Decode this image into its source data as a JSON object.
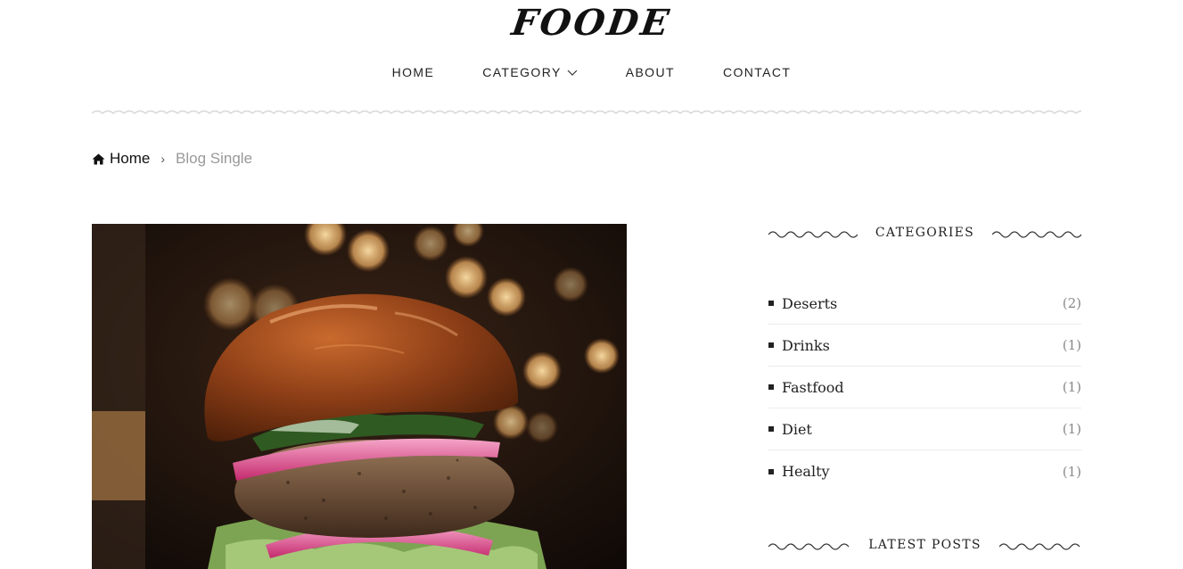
{
  "site": {
    "logo_text": "FOODE"
  },
  "nav": {
    "items": [
      {
        "label": "HOME"
      },
      {
        "label": "CATEGORY"
      },
      {
        "label": "ABOUT"
      },
      {
        "label": "CONTACT"
      }
    ]
  },
  "breadcrumb": {
    "home": "Home",
    "current": "Blog Single"
  },
  "sidebar": {
    "categories_title": "CATEGORIES",
    "categories": [
      {
        "name": "Deserts",
        "count": "(2)"
      },
      {
        "name": "Drinks",
        "count": "(1)"
      },
      {
        "name": "Fastfood",
        "count": "(1)"
      },
      {
        "name": "Diet",
        "count": "(1)"
      },
      {
        "name": "Healty",
        "count": "(1)"
      }
    ],
    "latest_posts_title": "LATEST POSTS"
  }
}
